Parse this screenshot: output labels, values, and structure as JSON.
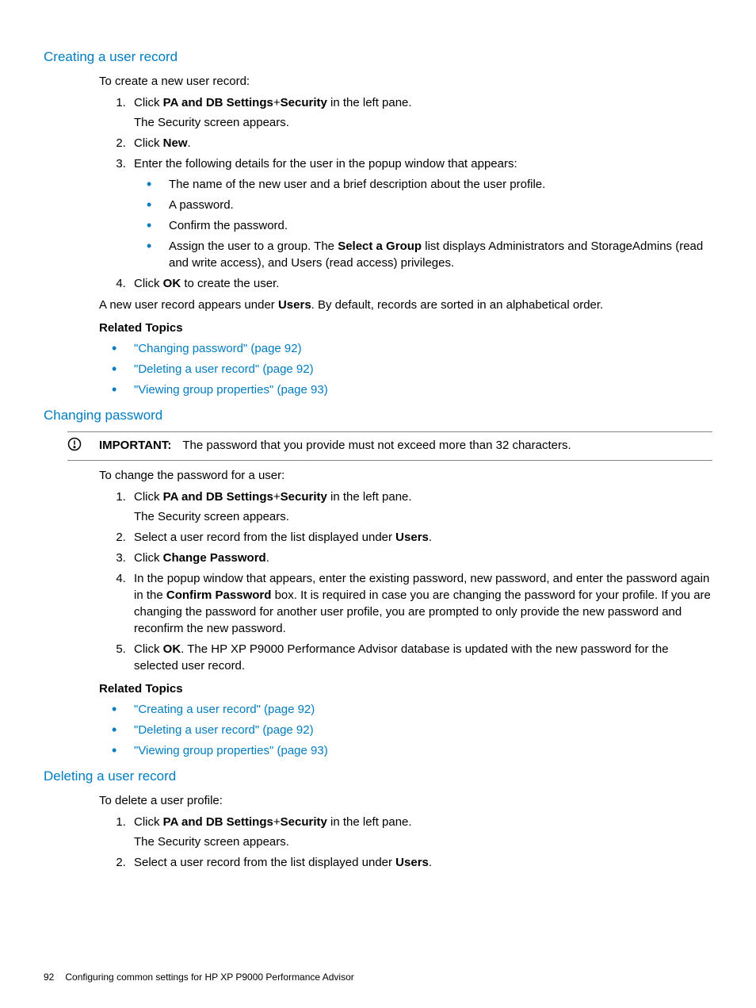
{
  "section1": {
    "heading": "Creating a user record",
    "intro": "To create a new user record:",
    "step1a": "Click ",
    "step1b": "PA and DB Settings",
    "step1c": "+",
    "step1d": "Security",
    "step1e": " in the left pane.",
    "step1f": "The Security screen appears.",
    "step2a": "Click ",
    "step2b": "New",
    "step2c": ".",
    "step3": "Enter the following details for the user in the popup window that appears:",
    "bullet1": "The name of the new user and a brief description about the user profile.",
    "bullet2": "A password.",
    "bullet3": "Confirm the password.",
    "bullet4a": "Assign the user to a group. The ",
    "bullet4b": "Select a Group",
    "bullet4c": " list displays Administrators and StorageAdmins (read and write access), and Users (read access) privileges.",
    "step4a": "Click ",
    "step4b": "OK",
    "step4c": " to create the user.",
    "result_a": "A new user record appears under ",
    "result_b": "Users",
    "result_c": ". By default, records are sorted in an alphabetical order.",
    "related_heading": "Related Topics",
    "rel1": "\"Changing password\" (page 92)",
    "rel2": "\"Deleting a user record\" (page 92)",
    "rel3": "\"Viewing group properties\" (page 93)"
  },
  "section2": {
    "heading": "Changing password",
    "important_label": "IMPORTANT:",
    "important_text": "The password that you provide must not exceed more than 32 characters.",
    "intro": "To change the password for a user:",
    "step1a": "Click ",
    "step1b": "PA and DB Settings",
    "step1c": "+",
    "step1d": "Security",
    "step1e": " in the left pane.",
    "step1f": "The Security screen appears.",
    "step2a": "Select a user record from the list displayed under ",
    "step2b": "Users",
    "step2c": ".",
    "step3a": "Click ",
    "step3b": "Change Password",
    "step3c": ".",
    "step4a": "In the popup window that appears, enter the existing password, new password, and enter the password again in the ",
    "step4b": "Confirm Password",
    "step4c": " box. It is required in case you are changing the password for your profile. If you are changing the password for another user profile, you are prompted to only provide the new password and reconfirm the new password.",
    "step5a": "Click ",
    "step5b": "OK",
    "step5c": ". The HP XP P9000 Performance Advisor database is updated with the new password for the selected user record.",
    "related_heading": "Related Topics",
    "rel1": "\"Creating a user record\" (page 92)",
    "rel2": "\"Deleting a user record\" (page 92)",
    "rel3": "\"Viewing group properties\" (page 93)"
  },
  "section3": {
    "heading": "Deleting a user record",
    "intro": "To delete a user profile:",
    "step1a": "Click ",
    "step1b": "PA and DB Settings",
    "step1c": "+",
    "step1d": "Security",
    "step1e": " in the left pane.",
    "step1f": "The Security screen appears.",
    "step2a": "Select a user record from the list displayed under ",
    "step2b": "Users",
    "step2c": "."
  },
  "footer": {
    "page": "92",
    "chapter": "Configuring common settings for HP XP P9000 Performance Advisor"
  }
}
